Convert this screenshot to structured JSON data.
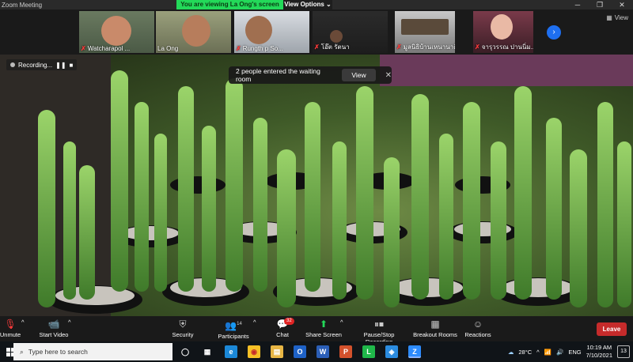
{
  "window": {
    "title": "Zoom Meeting",
    "share_banner": "You are viewing La Ong's screen",
    "view_options_label": "View Options",
    "view_options_caret": "⌄",
    "min_glyph": "─",
    "max_glyph": "❐",
    "close_glyph": "✕"
  },
  "gallery": {
    "participants": [
      {
        "name": "Watcharapol ...",
        "muted": true
      },
      {
        "name": "La Ong",
        "muted": false
      },
      {
        "name": "Rungth p So...",
        "muted": true
      },
      {
        "name": "โอ๊ต รัตนา",
        "muted": true
      },
      {
        "name": "มูลนิธิบ้านเหนานาดี",
        "muted": true
      },
      {
        "name": "จารุวรรณ ปานนิ่ม...",
        "muted": true
      }
    ],
    "mute_glyph": "✗",
    "next_glyph": "›",
    "view_label": "View"
  },
  "recording": {
    "label": "Recording...",
    "pause_glyph": "❚❚",
    "stop_glyph": "■"
  },
  "notification": {
    "text": "2 people entered the waiting room",
    "view_button": "View",
    "close_glyph": "✕"
  },
  "toolbar": {
    "unmute": "Unmute",
    "start_video": "Start Video",
    "security": "Security",
    "participants": "Participants",
    "participants_count": "14",
    "chat": "Chat",
    "chat_badge": "32",
    "share_screen": "Share Screen",
    "pause_stop_recording": "Pause/Stop Recording",
    "breakout_rooms": "Breakout Rooms",
    "reactions": "Reactions",
    "leave": "Leave",
    "caret": "^"
  },
  "taskbar": {
    "search_placeholder": "Type here to search",
    "search_glyph": "⌕",
    "pinned_glyphs": [
      "◯",
      "▦",
      "e",
      "◉",
      "▤",
      "O",
      "W",
      "P",
      "L",
      "◈",
      "Z"
    ],
    "weather": "28°C",
    "tray_caret": "^",
    "lang": "ENG",
    "time": "10:19 AM",
    "date": "7/10/2021",
    "notif_count": "13"
  },
  "colors": {
    "share_banner_bg": "#23d959",
    "leave_bg": "#c62b2b",
    "share_icon": "#23d959",
    "next_button": "#1e6ff0",
    "badge": "#e02424"
  }
}
